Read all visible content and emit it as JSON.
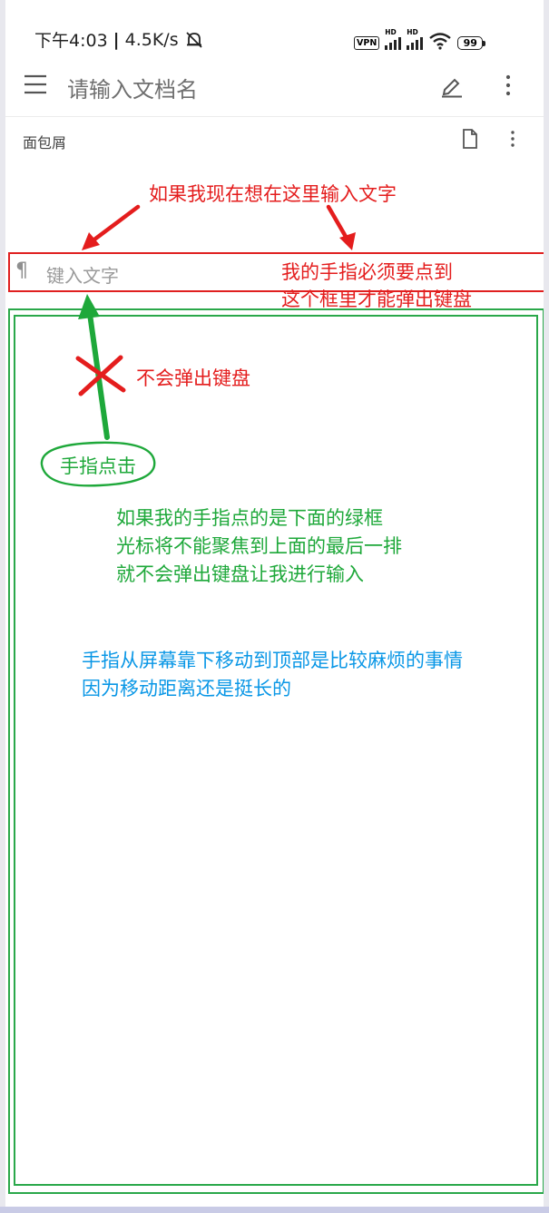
{
  "status_bar": {
    "time": "下午4:03",
    "speed": "4.5K/s",
    "vpn": "VPN",
    "hd": "HD",
    "battery": "99"
  },
  "toolbar": {
    "document_name_placeholder": "请输入文档名"
  },
  "breadcrumb": {
    "label": "面包屑"
  },
  "editor": {
    "input_placeholder": "键入文字"
  },
  "annotations": {
    "red_top": "如果我现在想在这里输入文字",
    "red_right_line1": "我的手指必须要点到",
    "red_right_line2": "这个框里才能弹出键盘",
    "no_keyboard": "不会弹出键盘",
    "finger_tap": "手指点击",
    "green_line1": "如果我的手指点的是下面的绿框",
    "green_line2": "光标将不能聚焦到上面的最后一排",
    "green_line3": "就不会弹出键盘让我进行输入",
    "blue_line1": "手指从屏幕靠下移动到顶部是比较麻烦的事情",
    "blue_line2": "因为移动距离还是挺长的"
  },
  "colors": {
    "annotation_red": "#e41d1d",
    "annotation_green": "#1ea83a",
    "annotation_blue": "#0a97e6"
  }
}
